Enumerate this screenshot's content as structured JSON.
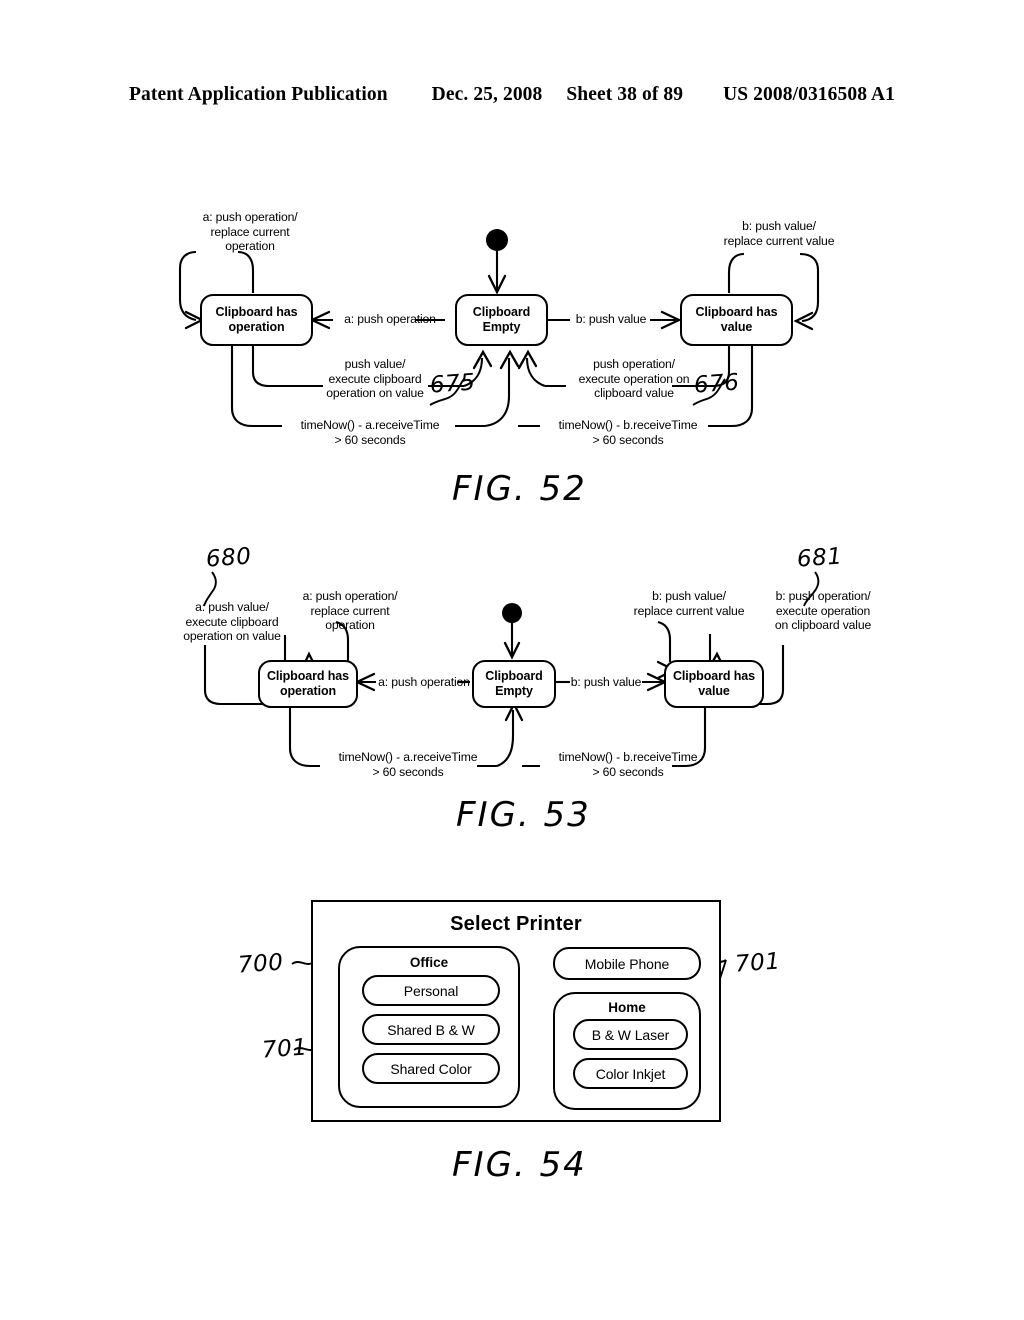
{
  "header": {
    "publication": "Patent Application Publication",
    "date": "Dec. 25, 2008",
    "sheet": "Sheet 38 of 89",
    "docnumber": "US 2008/0316508 A1"
  },
  "fig52": {
    "label": "FIG. 52",
    "states": {
      "has_operation": "Clipboard has\noperation",
      "empty": "Clipboard\nEmpty",
      "has_value": "Clipboard has\nvalue"
    },
    "transitions": {
      "self_operation": "a: push operation/\nreplace current\noperation",
      "empty_to_operation": "a: push operation",
      "empty_to_value": "b: push value",
      "self_value": "b: push value/\nreplace current value",
      "operation_to_empty": "push value/\nexecute clipboard\noperation on value",
      "value_to_empty": "push operation/\nexecute operation on\nclipboard value",
      "timeout_a": "timeNow() - a.receiveTime\n> 60 seconds",
      "timeout_b": "timeNow() - b.receiveTime\n> 60 seconds"
    },
    "refs": {
      "left": "675",
      "right": "676"
    }
  },
  "fig53": {
    "label": "FIG. 53",
    "states": {
      "has_operation": "Clipboard has\noperation",
      "empty": "Clipboard\nEmpty",
      "has_value": "Clipboard has\nvalue"
    },
    "transitions": {
      "push_value_exec": "a: push value/\nexecute clipboard\noperation on value",
      "self_operation": "a: push operation/\nreplace current\noperation",
      "empty_to_operation": "a: push operation",
      "empty_to_value": "b: push value",
      "self_value": "b: push value/\nreplace current value",
      "push_operation_exec": "b: push operation/\nexecute operation\non clipboard value",
      "timeout_a": "timeNow() - a.receiveTime\n> 60 seconds",
      "timeout_b": "timeNow() - b.receiveTime\n> 60 seconds"
    },
    "refs": {
      "left": "680",
      "right": "681"
    }
  },
  "fig54": {
    "label": "FIG. 54",
    "dialog_title": "Select Printer",
    "groups": {
      "office": {
        "title": "Office",
        "items": [
          "Personal",
          "Shared B & W",
          "Shared Color"
        ]
      },
      "home": {
        "title": "Home",
        "items": [
          "B & W Laser",
          "Color Inkjet"
        ]
      }
    },
    "standalone": {
      "label": "Mobile Phone"
    },
    "refs": {
      "dialog": "700",
      "group_left": "701",
      "group_right": "701"
    }
  }
}
